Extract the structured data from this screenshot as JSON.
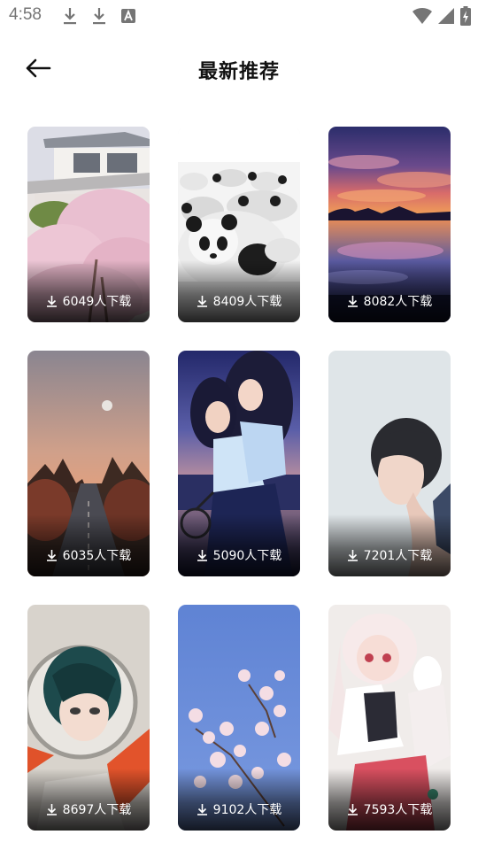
{
  "status_bar": {
    "time": "4:58",
    "icons": [
      "download-icon",
      "download-icon",
      "text-a-icon",
      "wifi-icon",
      "signal-icon",
      "battery-charging-icon"
    ]
  },
  "header": {
    "title": "最新推荐",
    "back_icon": "arrow-left-icon"
  },
  "wallpapers": [
    {
      "downloads": "6049人下载",
      "subject": "house-cherry-blossom"
    },
    {
      "downloads": "8409人下载",
      "subject": "pandas"
    },
    {
      "downloads": "8082人下载",
      "subject": "sunset-lake"
    },
    {
      "downloads": "6035人下载",
      "subject": "dusk-road-moon"
    },
    {
      "downloads": "5090人下载",
      "subject": "anime-girls-bike"
    },
    {
      "downloads": "7201人下载",
      "subject": "young-man-portrait"
    },
    {
      "downloads": "8697人下载",
      "subject": "anime-astronaut"
    },
    {
      "downloads": "9102人下载",
      "subject": "cherry-blossom-sky"
    },
    {
      "downloads": "7593人下载",
      "subject": "anime-girl-rabbit"
    }
  ],
  "colors": {
    "text_dark": "#111111",
    "status_gray": "#757575",
    "caption": "#ffffff"
  }
}
